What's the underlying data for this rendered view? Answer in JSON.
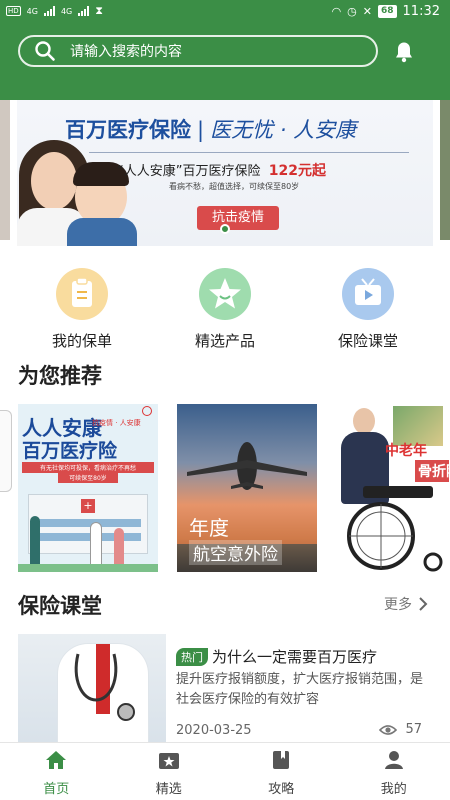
{
  "status_bar": {
    "time": "11:32",
    "battery": "68",
    "network_a": "4G",
    "network_b": "4G",
    "hd": "HD"
  },
  "header": {
    "search_placeholder": "请输入搜索的内容",
    "accent_color": "#3b8e46"
  },
  "banner": {
    "title": "百万医疗保险",
    "separator": "|",
    "slogan": "医无忧 · 人安康",
    "sub_title": "“人人安康”百万医疗保险",
    "price": "122元起",
    "note": "看病不愁，超值选择，可续保至80岁",
    "button": "抗击疫情"
  },
  "quick_entries": [
    {
      "label": "我的保单",
      "icon": "policy-icon",
      "color": "#f7d99b"
    },
    {
      "label": "精选产品",
      "icon": "star-icon",
      "color": "#9fdcae"
    },
    {
      "label": "保险课堂",
      "icon": "tv-icon",
      "color": "#a9c9ee"
    }
  ],
  "recommend": {
    "title": "为您推荐",
    "cards": [
      {
        "line1": "人人安康",
        "line2": "百万医疗险",
        "tag": "抗疫情 · 人安康",
        "caption": "有无社保均可投保，看病治疗不再愁",
        "caption2": "可续保至80岁"
      },
      {
        "line1": "年度",
        "line2": "航空意外险"
      },
      {
        "line1": "中老年",
        "line2": "骨折险"
      }
    ]
  },
  "classroom": {
    "title": "保险课堂",
    "more": "更多",
    "article": {
      "tag": "热门",
      "title": "为什么一定需要百万医疗",
      "desc": "提升医疗报销额度，扩大医疗报销范围，是社会医疗保险的有效扩容",
      "date": "2020-03-25",
      "views": "57"
    }
  },
  "bottom_nav": [
    {
      "label": "首页",
      "icon": "home-icon",
      "active": true
    },
    {
      "label": "精选",
      "icon": "featured-icon",
      "active": false
    },
    {
      "label": "攻略",
      "icon": "guide-book-icon",
      "active": false
    },
    {
      "label": "我的",
      "icon": "profile-icon",
      "active": false
    }
  ]
}
